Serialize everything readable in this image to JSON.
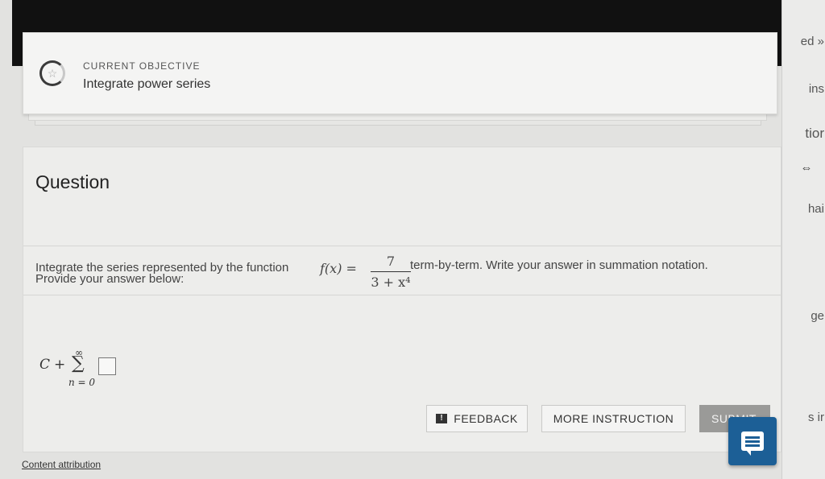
{
  "objective": {
    "label": "CURRENT OBJECTIVE",
    "title": "Integrate power series",
    "icon": "star-icon"
  },
  "question": {
    "heading": "Question",
    "text_before": "Integrate the series represented by the function",
    "func_lhs": "f(x) =",
    "frac_num": "7",
    "frac_den": "3 + x⁴",
    "text_after": "term-by-term. Write your answer in summation notation.",
    "prompt": "Provide your answer below:"
  },
  "answer": {
    "const": "C",
    "plus": "+",
    "sigma": "∑",
    "upper": "∞",
    "lower": "n = 0",
    "value": ""
  },
  "buttons": {
    "feedback": "FEEDBACK",
    "more_instruction": "MORE INSTRUCTION",
    "submit": "SUBMIT"
  },
  "footer": {
    "attribution": "Content attribution"
  },
  "right_strip": {
    "fragments": [
      "ed »",
      "ins",
      "tior",
      "hai",
      "ge",
      "s ir"
    ]
  },
  "colors": {
    "accent": "#1c5f96",
    "submit_bg": "#9a9a98",
    "top_bar": "#111111"
  }
}
